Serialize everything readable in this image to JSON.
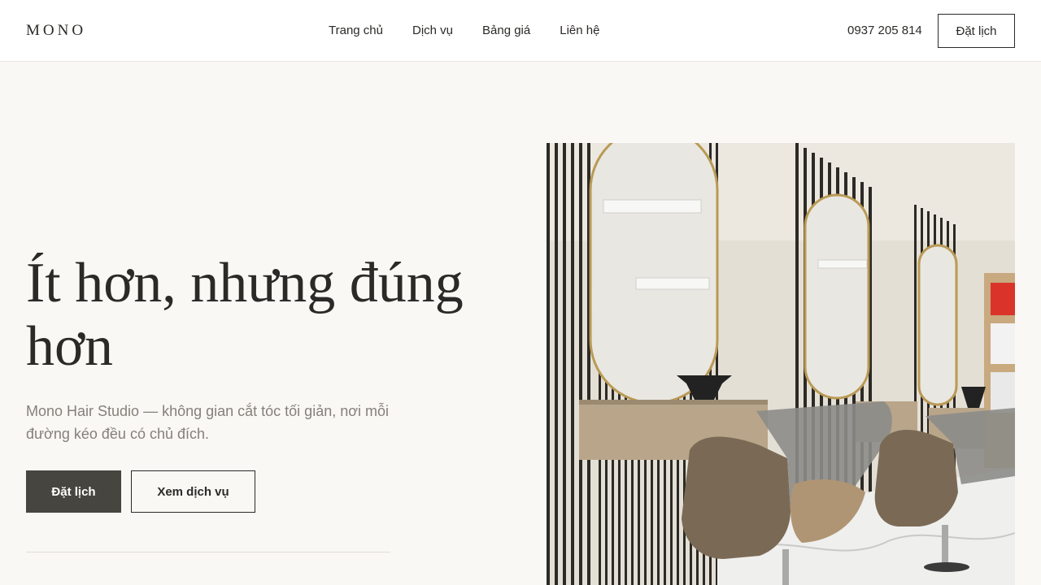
{
  "header": {
    "logo": "MONO",
    "nav": [
      "Trang chủ",
      "Dịch vụ",
      "Bảng giá",
      "Liên hệ"
    ],
    "phone": "0937 205 814",
    "cta": "Đặt lịch"
  },
  "hero": {
    "title": "Ít hơn, nhưng đúng hơn",
    "description": "Mono Hair Studio — không gian cắt tóc tối giản, nơi mỗi đường kéo đều có chủ đích.",
    "primary_button": "Đặt lịch",
    "secondary_button": "Xem dịch vụ",
    "image_icon": "salon-interior-photo"
  },
  "colors": {
    "background": "#f9f8f5",
    "text": "#2b2a27",
    "muted_text": "#85807a",
    "primary_button_bg": "#46453f"
  }
}
